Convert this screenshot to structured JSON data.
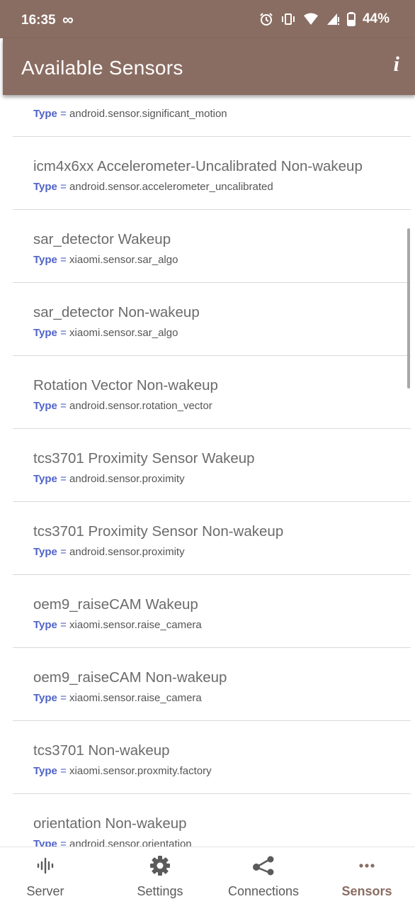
{
  "status_bar": {
    "time": "16:35",
    "infinity": "∞",
    "battery": "44%"
  },
  "app_bar": {
    "title": "Available Sensors",
    "info_label": "i"
  },
  "type_prefix": "Type",
  "type_eq": " = ",
  "sensors": [
    {
      "name": "",
      "type": "android.sensor.significant_motion"
    },
    {
      "name": "icm4x6xx Accelerometer-Uncalibrated Non-wakeup",
      "type": "android.sensor.accelerometer_uncalibrated"
    },
    {
      "name": "sar_detector  Wakeup",
      "type": "xiaomi.sensor.sar_algo"
    },
    {
      "name": "sar_detector  Non-wakeup",
      "type": "xiaomi.sensor.sar_algo"
    },
    {
      "name": "Rotation Vector  Non-wakeup",
      "type": "android.sensor.rotation_vector"
    },
    {
      "name": "tcs3701 Proximity Sensor Wakeup",
      "type": "android.sensor.proximity"
    },
    {
      "name": "tcs3701 Proximity Sensor Non-wakeup",
      "type": "android.sensor.proximity"
    },
    {
      "name": "oem9_raiseCAM  Wakeup",
      "type": "xiaomi.sensor.raise_camera"
    },
    {
      "name": "oem9_raiseCAM  Non-wakeup",
      "type": "xiaomi.sensor.raise_camera"
    },
    {
      "name": "tcs3701  Non-wakeup",
      "type": "xiaomi.sensor.proxmity.factory"
    },
    {
      "name": "orientation  Non-wakeup",
      "type": "android.sensor.orientation"
    }
  ],
  "bottom_nav": [
    {
      "label": "Server",
      "icon": "waveform-icon",
      "active": false
    },
    {
      "label": "Settings",
      "icon": "gear-icon",
      "active": false
    },
    {
      "label": "Connections",
      "icon": "share-nodes-icon",
      "active": false
    },
    {
      "label": "Sensors",
      "icon": "more-dots-icon",
      "active": true
    }
  ]
}
